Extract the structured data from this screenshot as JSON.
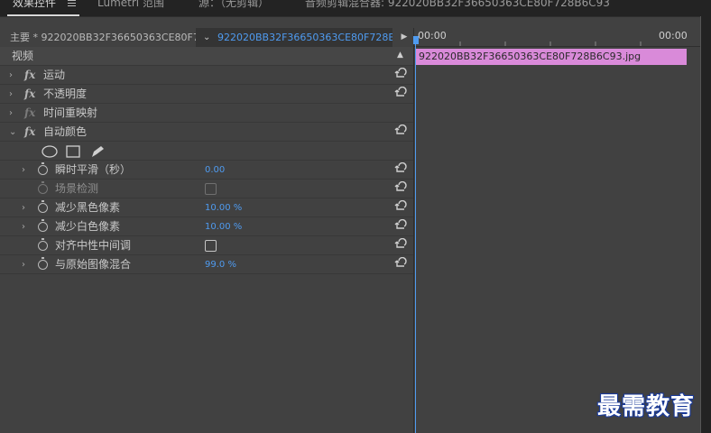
{
  "tabs": [
    {
      "label": "效果控件",
      "active": true
    },
    {
      "label": "Lumetri 范围",
      "active": false
    },
    {
      "label": "源：（无剪辑）",
      "active": false
    },
    {
      "label": "音频剪辑混合器: 922020BB32F36650363CE80F728B6C93",
      "active": false
    }
  ],
  "header": {
    "master": "主要 * 922020BB32F36650363CE80F7...",
    "clip": "922020BB32F36650363CE80F728B...",
    "chevron": "⌄",
    "play": "▶"
  },
  "timeline": {
    "start_time": "00:00",
    "end_time": "00:00",
    "clip_name": "922020BB32F36650363CE80F728B6C93.jpg",
    "clip_color": "#d98ad9"
  },
  "effects": {
    "section_label": "视频",
    "items": [
      {
        "label": "运动",
        "fx": "fx"
      },
      {
        "label": "不透明度",
        "fx": "fx"
      },
      {
        "label": "时间重映射",
        "fx": "fx"
      },
      {
        "label": "自动颜色",
        "fx": "fx"
      }
    ],
    "params": [
      {
        "label": "瞬时平滑（秒）",
        "value": "0.00"
      },
      {
        "label": "场景检测"
      },
      {
        "label": "减少黑色像素",
        "value": "10.00 %"
      },
      {
        "label": "减少白色像素",
        "value": "10.00 %"
      },
      {
        "label": "对齐中性中间调"
      },
      {
        "label": "与原始图像混合",
        "value": "99.0 %"
      }
    ]
  },
  "watermark": "最需教育",
  "colors": {
    "accent": "#4f9bf0",
    "panel": "#414141",
    "background": "#232323"
  }
}
